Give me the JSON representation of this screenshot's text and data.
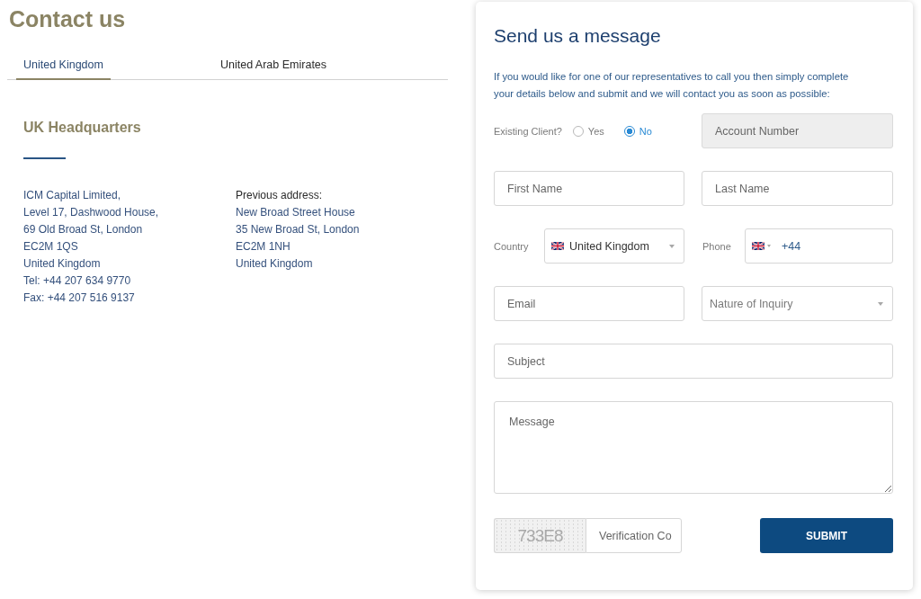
{
  "page_title": "Contact us",
  "tabs": [
    {
      "label": "United Kingdom",
      "selected": true
    },
    {
      "label": "United Arab Emirates",
      "selected": false
    }
  ],
  "office": {
    "heading": "UK Headquarters",
    "address": [
      "ICM Capital Limited,",
      "Level 17, Dashwood House,",
      "69 Old Broad St, London",
      "EC2M 1QS",
      "United Kingdom",
      "Tel: +44 207 634 9770",
      "Fax: +44 207 516 9137"
    ],
    "previous_address": {
      "heading": "Previous address:",
      "lines": [
        "New Broad Street House",
        "35 New Broad St, London",
        "EC2M 1NH",
        "United Kingdom"
      ]
    }
  },
  "form": {
    "title": "Send us a message",
    "intro": "If you would like for one of our representatives to call you then simply complete your details below and submit and we will contact you as soon as possible:",
    "existing_client": {
      "label": "Existing Client?",
      "options": [
        {
          "label": "Yes",
          "selected": false
        },
        {
          "label": "No",
          "selected": true
        }
      ]
    },
    "account_number": {
      "placeholder": "Account Number",
      "disabled": true
    },
    "first_name": {
      "placeholder": "First Name"
    },
    "last_name": {
      "placeholder": "Last Name"
    },
    "country": {
      "label": "Country",
      "value": "United Kingdom"
    },
    "phone": {
      "label": "Phone",
      "value": "+44"
    },
    "email": {
      "placeholder": "Email"
    },
    "inquiry": {
      "placeholder": "Nature of Inquiry"
    },
    "subject": {
      "placeholder": "Subject"
    },
    "message": {
      "placeholder": "Message"
    },
    "captcha": {
      "code": "733E8",
      "placeholder": "Verification Co"
    },
    "submit": "SUBMIT"
  }
}
